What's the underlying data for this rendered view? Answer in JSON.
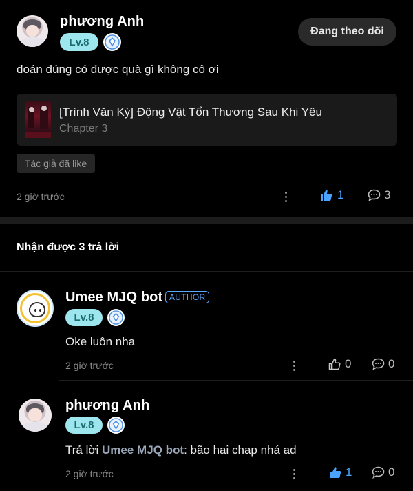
{
  "post": {
    "author_name": "phương Anh",
    "level": "Lv.8",
    "follow_label": "Đang theo dõi",
    "text": "đoán đúng có được quà gì không cô ơi",
    "linked_story": {
      "title": "[Trình Văn Kỳ] Động Vật Tổn Thương Sau Khi Yêu",
      "chapter": "Chapter 3"
    },
    "tag": "Tác giả đã like",
    "time": "2 giờ trước",
    "likes": "1",
    "comments": "3"
  },
  "replies_header": "Nhận được 3 trả lời",
  "replies": [
    {
      "author_name": "Umee MJQ bot",
      "author_tag": "AUTHOR",
      "level": "Lv.8",
      "text": "Oke luôn nha",
      "time": "2 giờ trước",
      "likes": "0",
      "comments": "0"
    },
    {
      "author_name": "phương Anh",
      "level": "Lv.8",
      "reply_prefix": "Trả lời",
      "reply_to": "Umee MJQ bot",
      "reply_suffix": ": bão hai chap nhá ad",
      "time": "2 giờ trước",
      "likes": "1",
      "comments": "0"
    }
  ],
  "colors": {
    "background": "#000000",
    "accent_blue": "#4aa3ff",
    "level_badge": "#9ee6ee"
  },
  "icons": [
    "thumbs-up-icon",
    "comment-icon",
    "more-icon",
    "shield-icon"
  ]
}
